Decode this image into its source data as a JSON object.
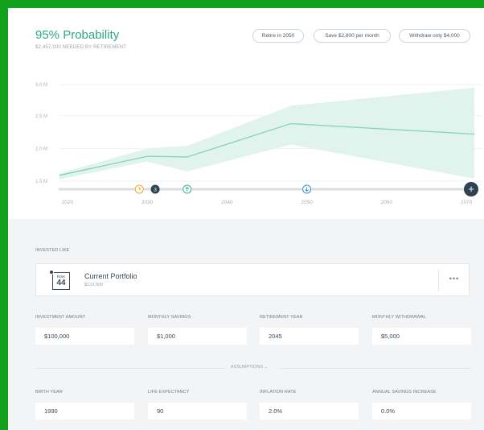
{
  "header": {
    "title": "95% Probability",
    "subtitle": "$2,457,000 NEEDED BY RETIREMENT",
    "buttons": [
      "Retire in 2050",
      "Save $2,800 per month",
      "Withdraw only $4,000"
    ]
  },
  "chart_data": {
    "type": "area",
    "y_ticks": [
      "3.0 M",
      "2.5 M",
      "2.0 M",
      "1.5 M"
    ],
    "y_tick_values": [
      3.0,
      2.5,
      2.0,
      1.5
    ],
    "x_ticks": [
      "2020",
      "2030",
      "2040",
      "2050",
      "2060",
      "2070"
    ],
    "x_tick_values": [
      2020,
      2030,
      2040,
      2050,
      2060,
      2070
    ],
    "ylim": [
      1.5,
      3.0
    ],
    "xlim": [
      2019,
      2071
    ],
    "grid": true,
    "series": [
      {
        "x": [
          2019,
          2030,
          2035,
          2048,
          2071
        ],
        "values": [
          1.59,
          1.88,
          1.87,
          2.38,
          2.22
        ]
      },
      {
        "x": [
          2019,
          2030,
          2035,
          2048,
          2071
        ],
        "lower": [
          1.53,
          1.8,
          1.65,
          2.06,
          1.54
        ],
        "upper": [
          1.62,
          2.0,
          2.04,
          2.66,
          2.95
        ]
      }
    ],
    "colors": {
      "line": "#84d3bb",
      "band": "#e0f3ec"
    },
    "timeline_markers": [
      {
        "year": 2029,
        "kind": "clock-icon",
        "color": "#f5a623"
      },
      {
        "year": 2031,
        "kind": "number",
        "label": "3",
        "color": "#2f4252"
      },
      {
        "year": 2035,
        "kind": "arrow-up-icon",
        "color": "#3fb58c"
      },
      {
        "year": 2050,
        "kind": "arrow-down-icon",
        "color": "#3a8fd6"
      }
    ],
    "add_button": "+"
  },
  "invested_like": {
    "label": "INVESTED LIKE",
    "risk_label": "RISK",
    "risk_value": "44",
    "portfolio_name": "Current Portfolio",
    "portfolio_value": "$123,000",
    "more": "•••"
  },
  "inputs": [
    {
      "label": "INVESTMENT AMOUNT",
      "value": "$100,000"
    },
    {
      "label": "MONTHLY SAVINGS",
      "value": "$1,000"
    },
    {
      "label": "RETIREMENT YEAR",
      "value": "2045"
    },
    {
      "label": "MONTHLY WITHDRAWAL",
      "value": "$5,000"
    }
  ],
  "assumptions_toggle": "ASSUMPTIONS ⌄",
  "assumptions": [
    {
      "label": "BIRTH YEAR",
      "value": "1990"
    },
    {
      "label": "LIFE EXPECTANCY",
      "value": "90"
    },
    {
      "label": "INFLATION RATE",
      "value": "2.0%"
    },
    {
      "label": "ANNUAL SAVINGS INCREASE",
      "value": "0.0%"
    }
  ]
}
